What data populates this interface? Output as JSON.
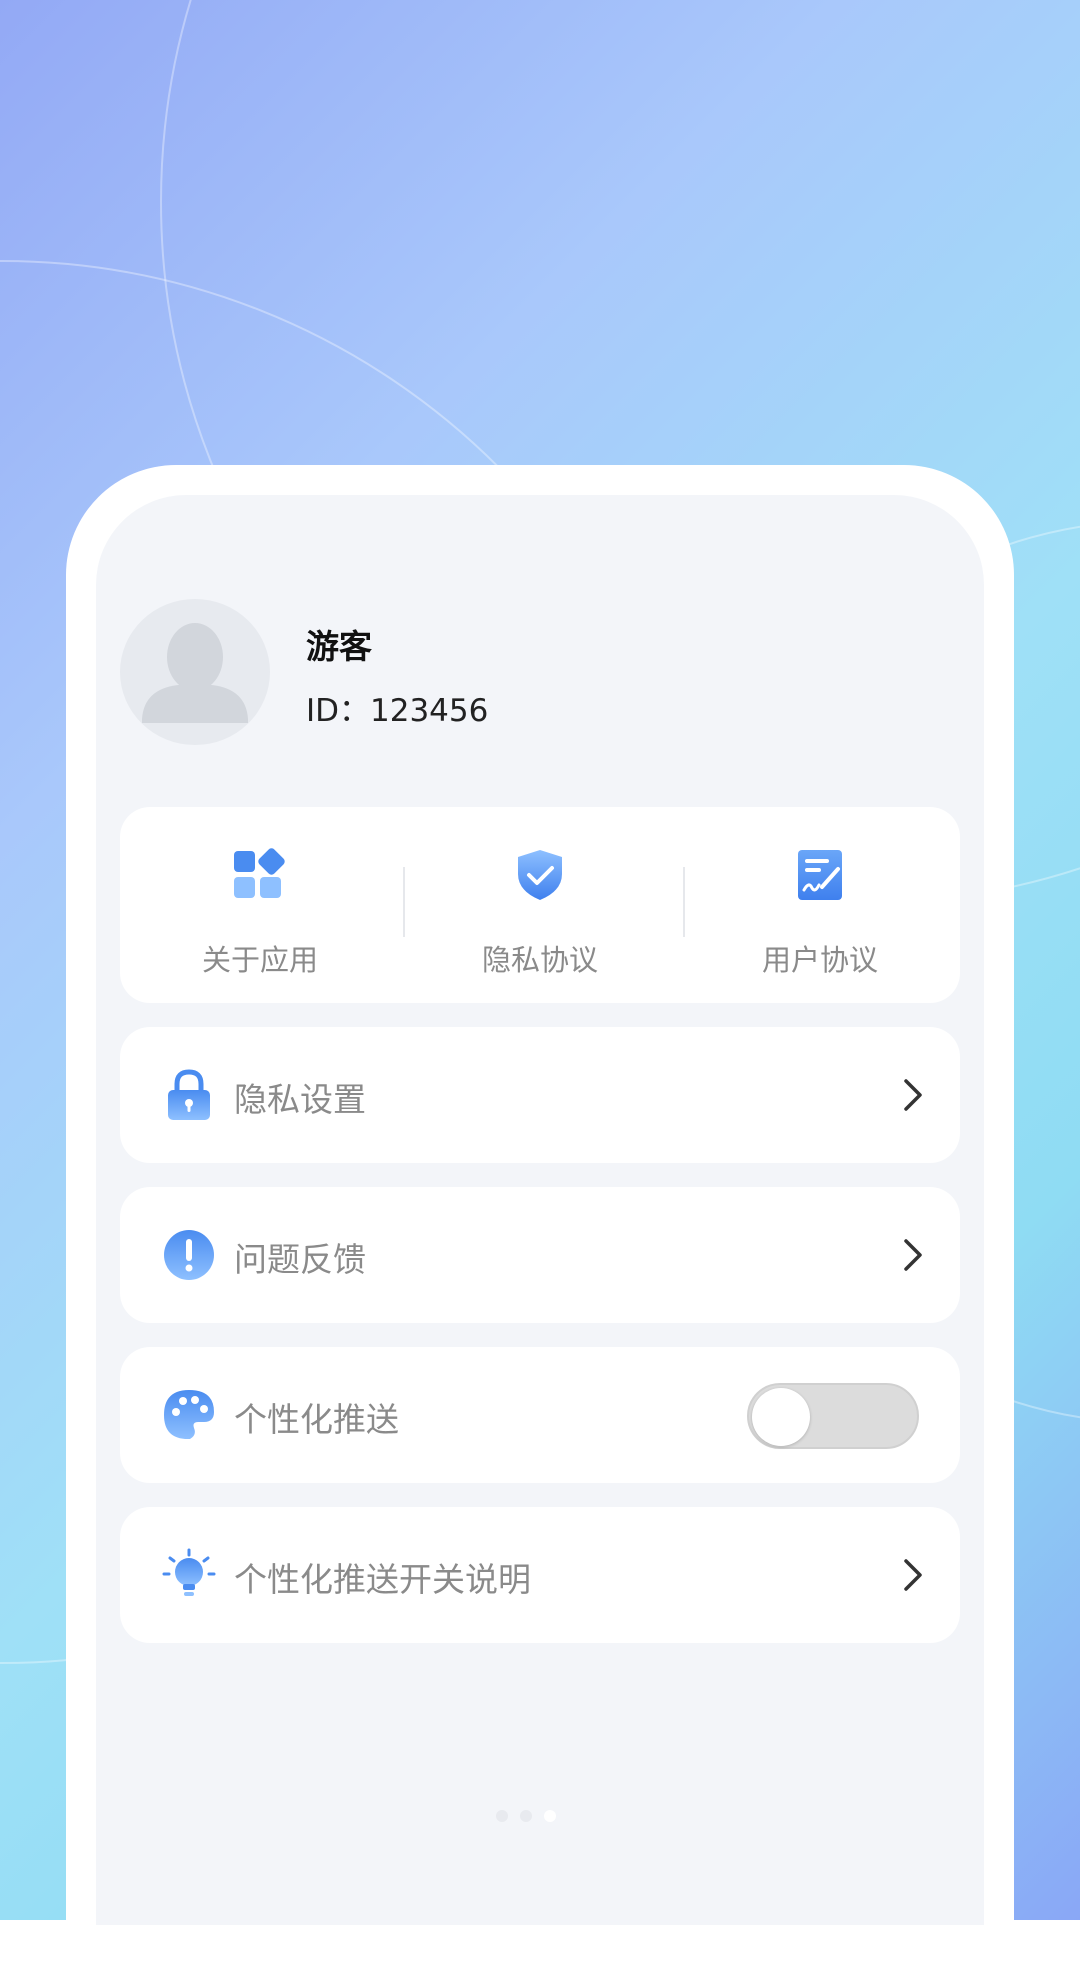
{
  "profile": {
    "name": "游客",
    "id_text": "ID：123456"
  },
  "quick_links": [
    {
      "label": "关于应用",
      "icon": "apps-grid-icon"
    },
    {
      "label": "隐私协议",
      "icon": "shield-check-icon"
    },
    {
      "label": "用户协议",
      "icon": "document-sign-icon"
    }
  ],
  "menu": [
    {
      "label": "隐私设置",
      "icon": "lock-icon",
      "control": "chevron"
    },
    {
      "label": "问题反馈",
      "icon": "exclamation-circle-icon",
      "control": "chevron"
    },
    {
      "label": "个性化推送",
      "icon": "palette-icon",
      "control": "toggle",
      "toggle_on": false
    },
    {
      "label": "个性化推送开关说明",
      "icon": "lightbulb-icon",
      "control": "chevron"
    }
  ],
  "colors": {
    "accent": "#4a8cf0",
    "accent_light": "#8ec0ff",
    "label": "#8a8a8a",
    "screen_bg": "#f3f5f9"
  },
  "page_indicator": {
    "count": 3,
    "active_index": 2
  }
}
